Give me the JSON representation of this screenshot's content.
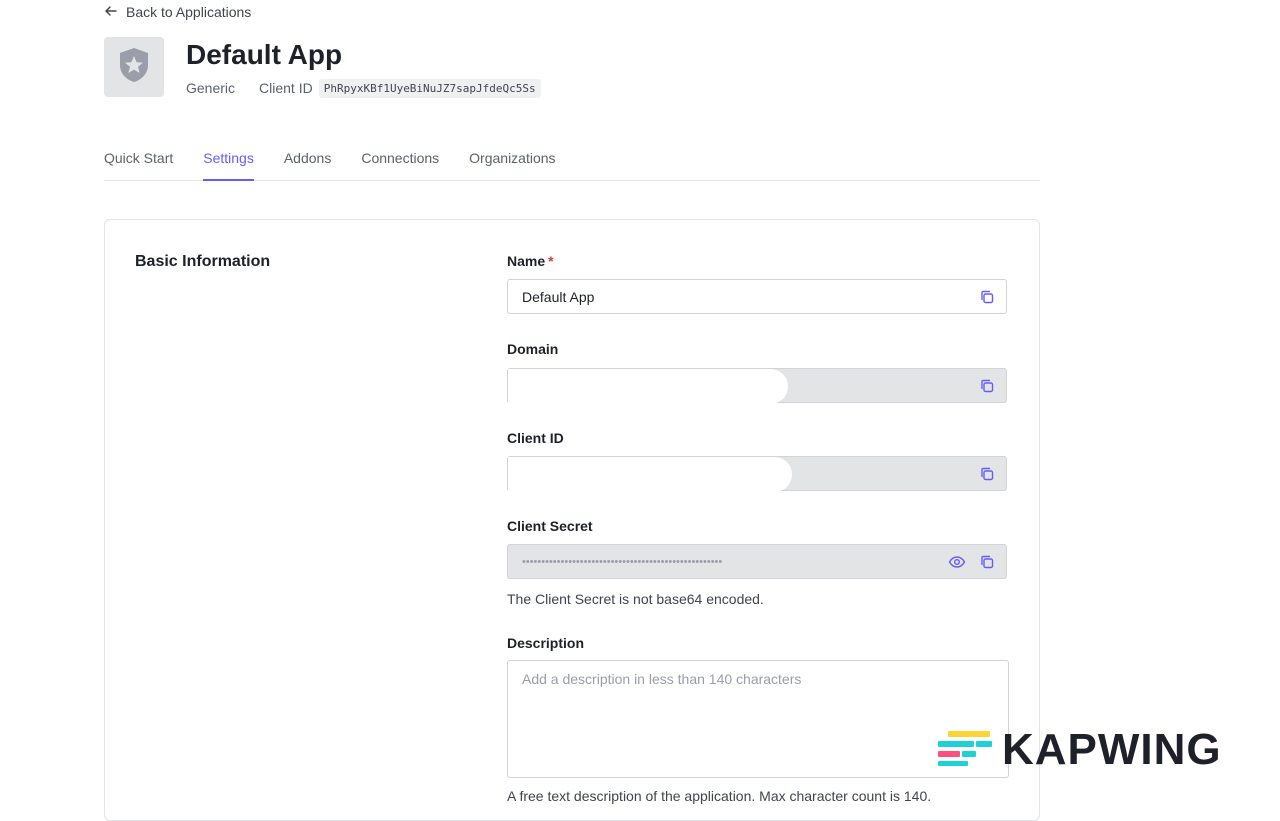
{
  "header": {
    "back_label": "Back to Applications",
    "app_name": "Default App",
    "app_type": "Generic",
    "client_id_label": "Client ID",
    "client_id_value": "PhRpyxKBf1UyeBiNuJZ7sapJfdeQc5Ss"
  },
  "tabs": [
    {
      "label": "Quick Start"
    },
    {
      "label": "Settings",
      "active": true
    },
    {
      "label": "Addons"
    },
    {
      "label": "Connections"
    },
    {
      "label": "Organizations"
    }
  ],
  "basic_info": {
    "section_title": "Basic Information",
    "name": {
      "label": "Name",
      "required_mark": "*",
      "value": "Default App",
      "icon": "copy-icon"
    },
    "domain": {
      "label": "Domain",
      "value": "",
      "icon": "copy-icon"
    },
    "client_id": {
      "label": "Client ID",
      "value": "",
      "icon": "copy-icon"
    },
    "client_secret": {
      "label": "Client Secret",
      "value": "••••••••••••••••••••••••••••••••••••••••••••••••••••",
      "help": "The Client Secret is not base64 encoded.",
      "icons": [
        "eye-icon",
        "copy-icon"
      ]
    },
    "description": {
      "label": "Description",
      "placeholder": "Add a description in less than 140 characters",
      "help": "A free text description of the application. Max character count is 140."
    }
  },
  "watermark": {
    "text": "KAPWING"
  },
  "colors": {
    "accent": "#635dff",
    "required": "#d03c38",
    "readonly_bg": "#e3e4e6"
  }
}
